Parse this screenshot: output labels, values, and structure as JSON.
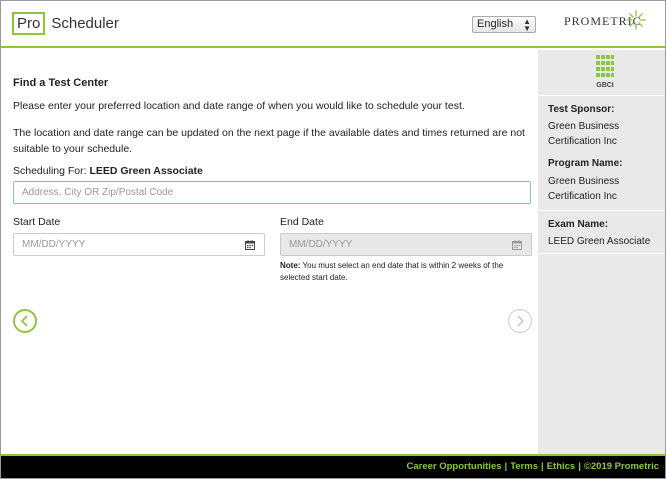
{
  "header": {
    "logo_box": "Pro",
    "logo_text": "Scheduler",
    "language": "English",
    "brand": "PROMETRIC"
  },
  "main": {
    "title": "Find a Test Center",
    "intro": "Please enter your preferred location and date range of when you would like to schedule your test.",
    "info": "The location and date range can be updated on the next page if the available dates and times returned are not suitable to your schedule.",
    "scheduling_for_label": "Scheduling For:",
    "scheduling_for_value": "LEED Green Associate",
    "address_placeholder": "Address, City OR Zip/Postal Code",
    "start_date_label": "Start Date",
    "start_date_placeholder": "MM/DD/YYYY",
    "end_date_label": "End Date",
    "end_date_placeholder": "MM/DD/YYYY",
    "note_label": "Note:",
    "note_text": "You must select an end date that is within 2 weeks of the selected start date."
  },
  "sidebar": {
    "logo_text": "GBCI",
    "test_sponsor_label": "Test Sponsor:",
    "test_sponsor_value": "Green Business Certification Inc",
    "program_name_label": "Program Name:",
    "program_name_value": "Green Business Certification Inc",
    "exam_name_label": "Exam Name:",
    "exam_name_value": "LEED Green Associate"
  },
  "footer": {
    "career": "Career Opportunities",
    "terms": "Terms",
    "ethics": "Ethics",
    "copyright": "©2019 Prometric",
    "separator": "|"
  },
  "colors": {
    "accent": "#8cc63f",
    "sidebar_bg": "#e9e9e9",
    "footer_bg": "#000000"
  }
}
